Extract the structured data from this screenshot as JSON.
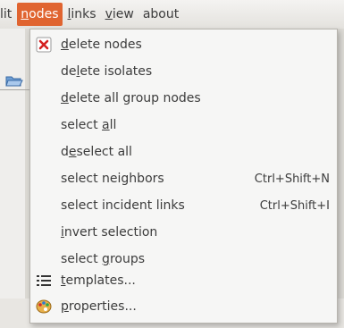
{
  "menubar": {
    "items": [
      {
        "pre": "",
        "acc": "",
        "post": "lit"
      },
      {
        "pre": "",
        "acc": "n",
        "post": "odes"
      },
      {
        "pre": "",
        "acc": "l",
        "post": "inks"
      },
      {
        "pre": "",
        "acc": "v",
        "post": "iew"
      },
      {
        "pre": "",
        "acc": "",
        "post": "about"
      }
    ]
  },
  "menu": {
    "items": [
      {
        "pre": "",
        "acc": "d",
        "post": "elete nodes",
        "shortcut": "",
        "icon": "delete-x-icon"
      },
      {
        "pre": "de",
        "acc": "l",
        "post": "ete isolates",
        "shortcut": "",
        "icon": ""
      },
      {
        "pre": "",
        "acc": "d",
        "post": "elete all group nodes",
        "shortcut": "",
        "icon": ""
      },
      {
        "pre": "select ",
        "acc": "a",
        "post": "ll",
        "shortcut": "",
        "icon": ""
      },
      {
        "pre": "d",
        "acc": "e",
        "post": "select all",
        "shortcut": "",
        "icon": ""
      },
      {
        "pre": "select neighbors",
        "acc": "",
        "post": "",
        "shortcut": "Ctrl+Shift+N",
        "icon": ""
      },
      {
        "pre": "select incident links",
        "acc": "",
        "post": "",
        "shortcut": "Ctrl+Shift+I",
        "icon": ""
      },
      {
        "pre": "",
        "acc": "i",
        "post": "nvert selection",
        "shortcut": "",
        "icon": ""
      },
      {
        "pre": "select ",
        "acc": "g",
        "post": "roups",
        "shortcut": "",
        "icon": ""
      },
      {
        "pre": "",
        "acc": "t",
        "post": "emplates...",
        "shortcut": "",
        "icon": "list-icon"
      },
      {
        "pre": "",
        "acc": "p",
        "post": "roperties...",
        "shortcut": "",
        "icon": "palette-icon"
      }
    ]
  },
  "colors": {
    "accent": "#e06430",
    "menu_bg": "#f6f6f5"
  }
}
